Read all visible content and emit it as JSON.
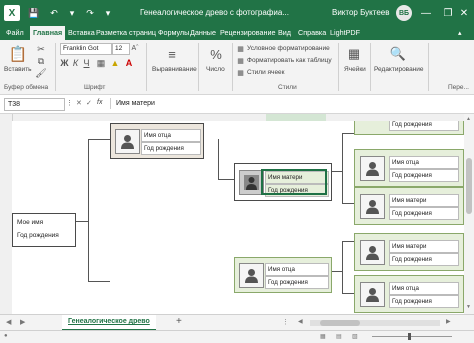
{
  "title_bar": {
    "doc_title": "Генеалогическое древо с фотографиа...",
    "user_name": "Виктор Буктеев",
    "user_initials": "ВБ",
    "window_buttons": [
      "minimize",
      "restore",
      "close"
    ]
  },
  "tabs": [
    "Файл",
    "Главная",
    "Вставка",
    "Разметка страниц",
    "Формулы",
    "Данные",
    "Рецензирование",
    "Вид",
    "Справка",
    "LightPDF"
  ],
  "active_tab": "Главная",
  "ribbon": {
    "paste_label": "Вставить",
    "clipboard_group": "Буфер обмена",
    "font_name": "Franklin Got",
    "font_size": "12",
    "font_group": "Шрифт",
    "alignment_label": "Выравнивание",
    "number_label": "Число",
    "cond_format": "Условное форматирование",
    "format_table": "Форматировать как таблицу",
    "cell_styles": "Стили ячеек",
    "styles_group": "Стили",
    "cells_label": "Ячейки",
    "editing_label": "Редактирование",
    "overflow_group": "Пере..."
  },
  "formula_bar": {
    "name_box": "T38",
    "fx": "fx",
    "value": "Имя матери"
  },
  "tree": {
    "left_card": {
      "name": "Мое имя",
      "year": "Год рождения"
    },
    "top_father": {
      "name": "Имя отца",
      "year": "Год рождения"
    },
    "selected_mother": {
      "name": "Имя матери",
      "year": "Год рождения"
    },
    "right_top_partial": {
      "year": "Год рождения"
    },
    "right_father_1": {
      "name": "Имя отца",
      "year": "Год рождения"
    },
    "right_mother_1": {
      "name": "Имя матери",
      "year": "Год рождения"
    },
    "mid_father": {
      "name": "Имя отца",
      "year": "Год рождения"
    },
    "right_mother_2": {
      "name": "Имя матери",
      "year": "Год рождения"
    },
    "right_father_2": {
      "name": "Имя отца",
      "year": "Год рождения"
    }
  },
  "sheet_tabs": {
    "active": "Генеалогическое древо",
    "add": "+"
  },
  "colors": {
    "excel_green": "#217346",
    "beige": "#ece6dd",
    "pale_green": "#e6efdb",
    "selection": "#1e7145"
  }
}
